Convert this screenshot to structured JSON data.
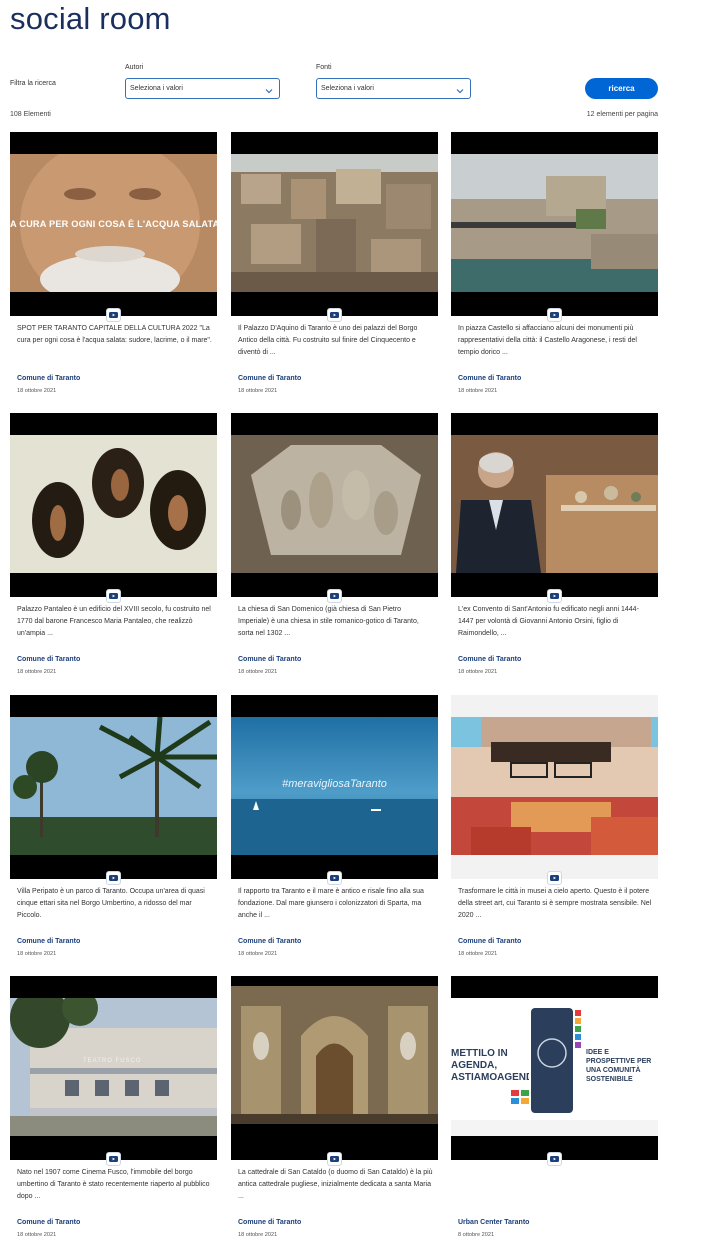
{
  "page": {
    "title": "social room"
  },
  "filters": {
    "label": "Filtra la ricerca",
    "autori": {
      "label": "Autori",
      "value": "Seleziona i valori"
    },
    "fonti": {
      "label": "Fonti",
      "value": "Seleziona i valori"
    },
    "search_button": "ricerca"
  },
  "results": {
    "count": "108 Elementi",
    "per_page": "12 elementi per pagina"
  },
  "cards": [
    {
      "desc": "SPOT PER TARANTO CAPITALE DELLA CULTURA 2022 \"La cura per ogni cosa è l'acqua salata: sudore, lacrime, o il mare\".",
      "author": "Comune di Taranto",
      "date": "18 ottobre 2021",
      "overlay": "A CURA PER OGNI COSA È L'ACQUA SALATA"
    },
    {
      "desc": "Il Palazzo D'Aquino di Taranto è uno dei palazzi del Borgo Antico della città. Fu costruito sul finire del Cinquecento e diventò di ...",
      "author": "Comune di Taranto",
      "date": "18 ottobre 2021"
    },
    {
      "desc": "In piazza Castello si affacciano alcuni dei monumenti più rappresentativi della città: il Castello Aragonese, i resti del tempio dorico ...",
      "author": "Comune di Taranto",
      "date": "18 ottobre 2021"
    },
    {
      "desc": "Palazzo Pantaleo è un edificio del XVIII secolo, fu costruito nel 1770 dal barone Francesco Maria Pantaleo, che realizzò un'ampia ...",
      "author": "Comune di Taranto",
      "date": "18 ottobre 2021"
    },
    {
      "desc": "La chiesa di San Domenico (già chiesa di San Pietro Imperiale) è una chiesa in stile romanico-gotico di Taranto, sorta nel 1302 ...",
      "author": "Comune di Taranto",
      "date": "18 ottobre 2021"
    },
    {
      "desc": "L'ex Convento di Sant'Antonio fu edificato negli anni 1444-1447 per volontà di Giovanni Antonio Orsini, figlio di Raimondello, ...",
      "author": "Comune di Taranto",
      "date": "18 ottobre 2021"
    },
    {
      "desc": "Villa Peripato è un parco di Taranto. Occupa un'area di quasi cinque ettari sita nel Borgo Umbertino, a ridosso del mar Piccolo.",
      "author": "Comune di Taranto",
      "date": "18 ottobre 2021"
    },
    {
      "desc": "Il rapporto tra Taranto e il mare è antico e risale fino alla sua fondazione. Dal mare giunsero i colonizzatori di Sparta, ma anche il ...",
      "author": "Comune di Taranto",
      "date": "18 ottobre 2021",
      "overlay": "#meravigliosaTaranto"
    },
    {
      "desc": "Trasformare le città in musei a cielo aperto. Questo è il potere della street art, cui Taranto si è sempre mostrata sensibile. Nel 2020 ...",
      "author": "Comune di Taranto",
      "date": "18 ottobre 2021"
    },
    {
      "desc": "Nato nel 1907 come Cinema Fusco, l'immobile del borgo umbertino di Taranto è stato recentemente riaperto al pubblico dopo ...",
      "author": "Comune di Taranto",
      "date": "18 ottobre 2021",
      "overlay": "TEATRO FUSCO"
    },
    {
      "desc": "La cattedrale di San Cataldo (o duomo di San Cataldo) è la più antica cattedrale pugliese, inizialmente dedicata a santa Maria ...",
      "author": "Comune di Taranto",
      "date": "18 ottobre 2021"
    },
    {
      "desc": "",
      "author": "Urban Center Taranto",
      "date": "8 ottobre 2021",
      "overlay": "METTILO IN AGENDA, ASTIAMOAGENDO",
      "overlay2": "IDEE E PROSPETTIVE PER UNA COMUNITÀ SOSTENIBILE"
    }
  ]
}
